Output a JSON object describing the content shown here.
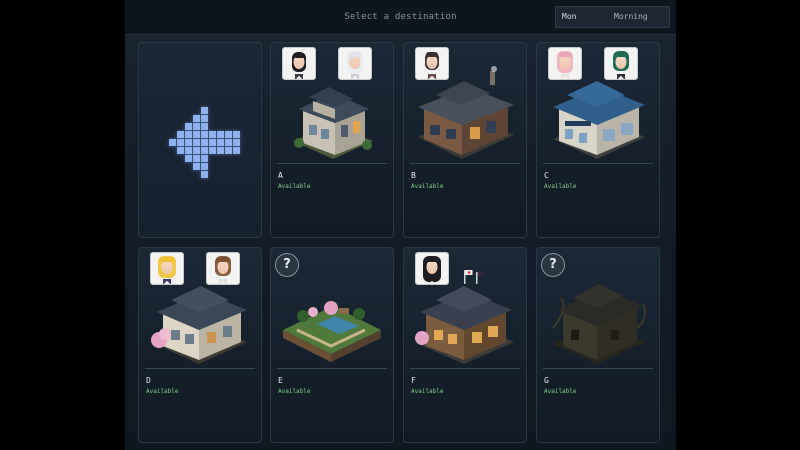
{
  "header": {
    "title": "Select a destination",
    "day": "Mon",
    "period": "Morning"
  },
  "back_button": {
    "icon": "pixel-arrow-left-icon"
  },
  "locations": [
    {
      "name": "A",
      "status": "Available",
      "portraits": [
        "black-haired-girl",
        "white-haired-girl"
      ],
      "unknown": false
    },
    {
      "name": "B",
      "status": "Available",
      "portraits": [
        "dark-haired-woman"
      ],
      "unknown": false
    },
    {
      "name": "C",
      "status": "Available",
      "portraits": [
        "pink-haired-girl",
        "green-haired-girl"
      ],
      "unknown": false
    },
    {
      "name": "D",
      "status": "Available",
      "portraits": [
        "blonde-girl",
        "brown-haired-girl"
      ],
      "unknown": false
    },
    {
      "name": "E",
      "status": "Available",
      "portraits": [],
      "unknown": true
    },
    {
      "name": "F",
      "status": "Available",
      "portraits": [
        "long-black-haired-girl"
      ],
      "unknown": false
    },
    {
      "name": "G",
      "status": "Available",
      "portraits": [],
      "unknown": true
    }
  ],
  "unknown_symbol": "?",
  "colors": {
    "available": "#7fd08a",
    "accent_arrow": "#7a9fe0"
  }
}
